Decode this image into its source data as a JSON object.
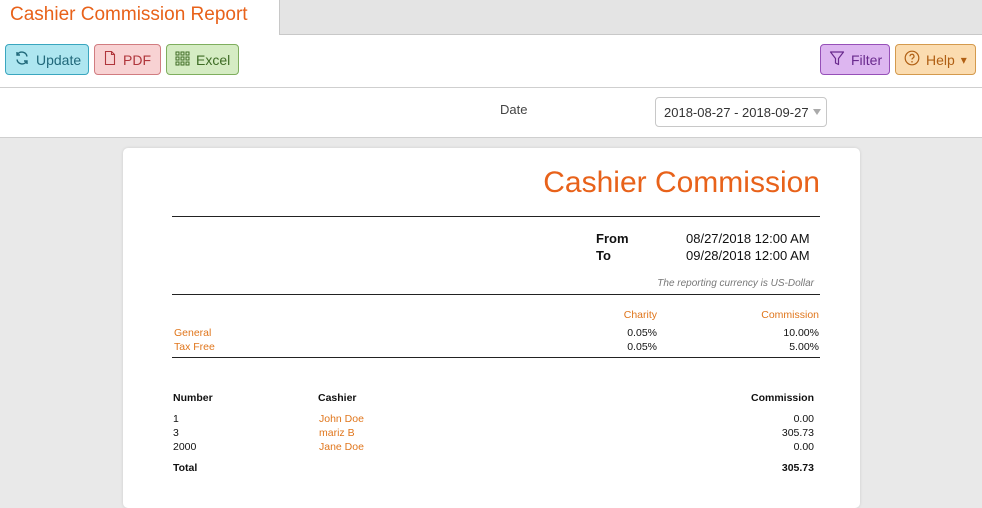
{
  "tab": {
    "title": "Cashier Commission Report"
  },
  "toolbar": {
    "update_label": "Update",
    "pdf_label": "PDF",
    "excel_label": "Excel",
    "filter_label": "Filter",
    "help_label": "Help",
    "help_caret": "▾"
  },
  "filters": {
    "date_label": "Date",
    "date_value": "2018-08-27 - 2018-09-27"
  },
  "report": {
    "title": "Cashier Commission",
    "from_label": "From",
    "from_value": "08/27/2018 12:00 AM",
    "to_label": "To",
    "to_value": "09/28/2018 12:00 AM",
    "currency_note": "The reporting currency is US-Dollar",
    "rates": {
      "columns": {
        "charity": "Charity",
        "commission": "Commission"
      },
      "rows": [
        {
          "name": "General",
          "charity": "0.05%",
          "commission": "10.00%"
        },
        {
          "name": "Tax Free",
          "charity": "0.05%",
          "commission": "5.00%"
        }
      ]
    },
    "table": {
      "columns": {
        "number": "Number",
        "cashier": "Cashier",
        "commission": "Commission"
      },
      "rows": [
        {
          "number": "1",
          "cashier": "John Doe",
          "commission": "0.00"
        },
        {
          "number": "3",
          "cashier": "mariz B",
          "commission": "305.73"
        },
        {
          "number": "2000",
          "cashier": "Jane Doe",
          "commission": "0.00"
        }
      ],
      "total_label": "Total",
      "total_value": "305.73"
    }
  },
  "colors": {
    "accent": "#e8621a",
    "update": "#aee6f0",
    "pdf": "#f8d2d3",
    "excel": "#d5ecc3",
    "filter": "#ddb6f0",
    "help": "#fbdcb0"
  },
  "icons": {
    "update": "refresh-icon",
    "pdf": "document-icon",
    "excel": "grid-icon",
    "filter": "funnel-icon",
    "help": "question-circle-icon"
  }
}
